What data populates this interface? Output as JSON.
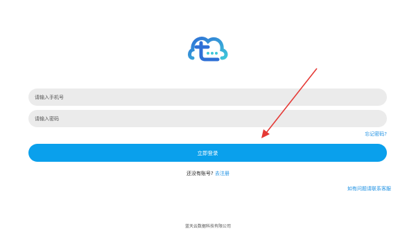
{
  "form": {
    "phone_placeholder": "请输入手机号",
    "password_placeholder": "请输入密码",
    "forgot_password": "忘记密码?",
    "login_button": "立即登录"
  },
  "register": {
    "prompt": "还没有账号?",
    "link": "去注册"
  },
  "help_link": "如有问题请联系客服",
  "footer": {
    "company": "蓝天云数据科技有限公司"
  },
  "icons": {
    "logo": "cloud-logo-icon"
  },
  "colors": {
    "primary": "#0aa0ec",
    "link": "#1a8fe3",
    "input_bg": "#ebebeb",
    "annotation_arrow": "#e53935"
  }
}
